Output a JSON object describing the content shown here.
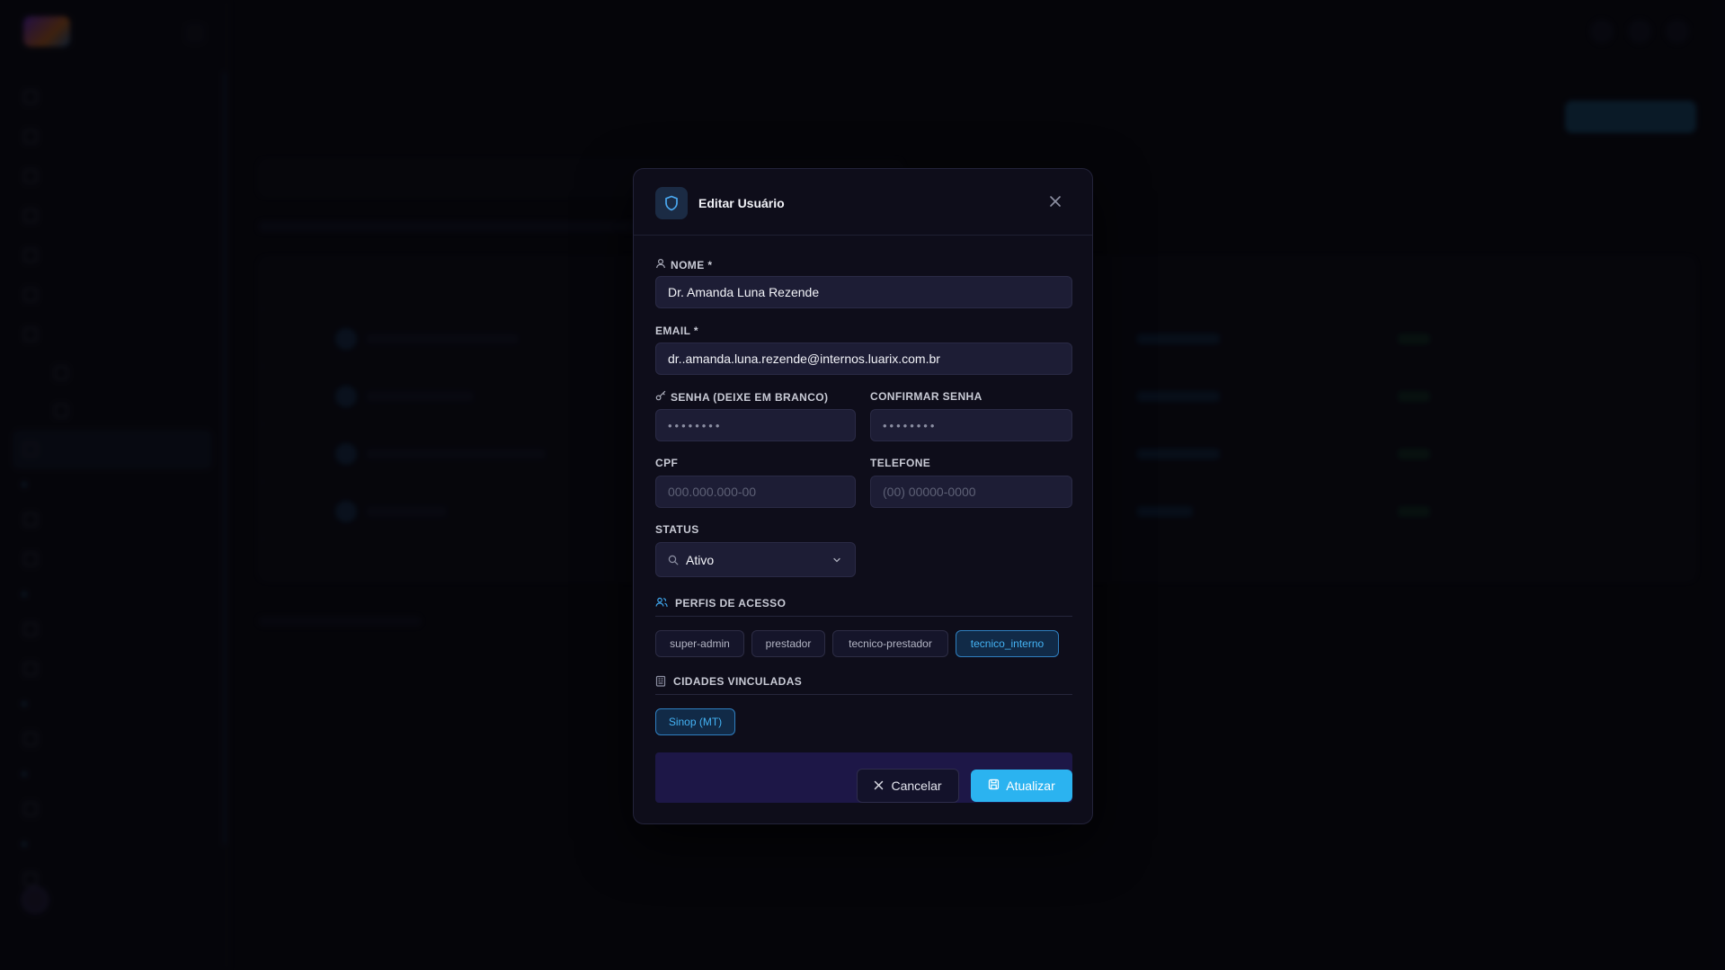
{
  "modal": {
    "title": "Editar Usuário",
    "fields": {
      "nome": {
        "label": "NOME *",
        "value": "Dr. Amanda Luna Rezende"
      },
      "email": {
        "label": "EMAIL *",
        "value": "dr..amanda.luna.rezende@internos.luarix.com.br"
      },
      "senha": {
        "label": "SENHA (DEIXE EM BRANCO)",
        "value": "••••••••"
      },
      "confirmar_senha": {
        "label": "CONFIRMAR SENHA",
        "value": "••••••••"
      },
      "cpf": {
        "label": "CPF",
        "placeholder": "000.000.000-00"
      },
      "telefone": {
        "label": "TELEFONE",
        "placeholder": "(00) 00000-0000"
      },
      "status": {
        "label": "STATUS",
        "value": "Ativo"
      }
    },
    "perfis": {
      "title": "PERFIS DE ACESSO",
      "items": [
        {
          "label": "super-admin",
          "selected": false
        },
        {
          "label": "prestador",
          "selected": false
        },
        {
          "label": "tecnico-prestador",
          "selected": false
        },
        {
          "label": "tecnico_interno",
          "selected": true
        }
      ]
    },
    "cidades": {
      "title": "CIDADES VINCULADAS",
      "items": [
        {
          "label": "Sinop (MT)",
          "selected": true
        }
      ]
    },
    "buttons": {
      "cancel": "Cancelar",
      "save": "Atualizar"
    }
  },
  "colors": {
    "accent": "#2bb3f0",
    "modal_bg": "#0e0d1a",
    "input_bg": "#1d1d35",
    "chip_active": "#44b2f3"
  }
}
